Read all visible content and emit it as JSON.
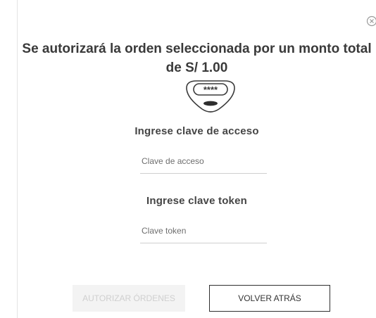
{
  "modal": {
    "title": "Se autorizará la orden seleccionada por un monto total de S/ 1.00",
    "token_icon": "token-device-icon",
    "close_icon": "close-icon",
    "access_key": {
      "label": "Ingrese clave de acceso",
      "placeholder": "Clave de acceso",
      "value": ""
    },
    "token_key": {
      "label": "Ingrese clave token",
      "placeholder": "Clave token",
      "value": ""
    },
    "buttons": {
      "authorize_label": "AUTORIZAR ÓRDENES",
      "back_label": "VOLVER ATRÁS"
    },
    "token_display": "****"
  },
  "colors": {
    "title": "#3a3a3a",
    "disabled_button_bg": "#f3f3f3",
    "disabled_button_text": "#cfcfcf",
    "border": "#2f2f2f"
  }
}
